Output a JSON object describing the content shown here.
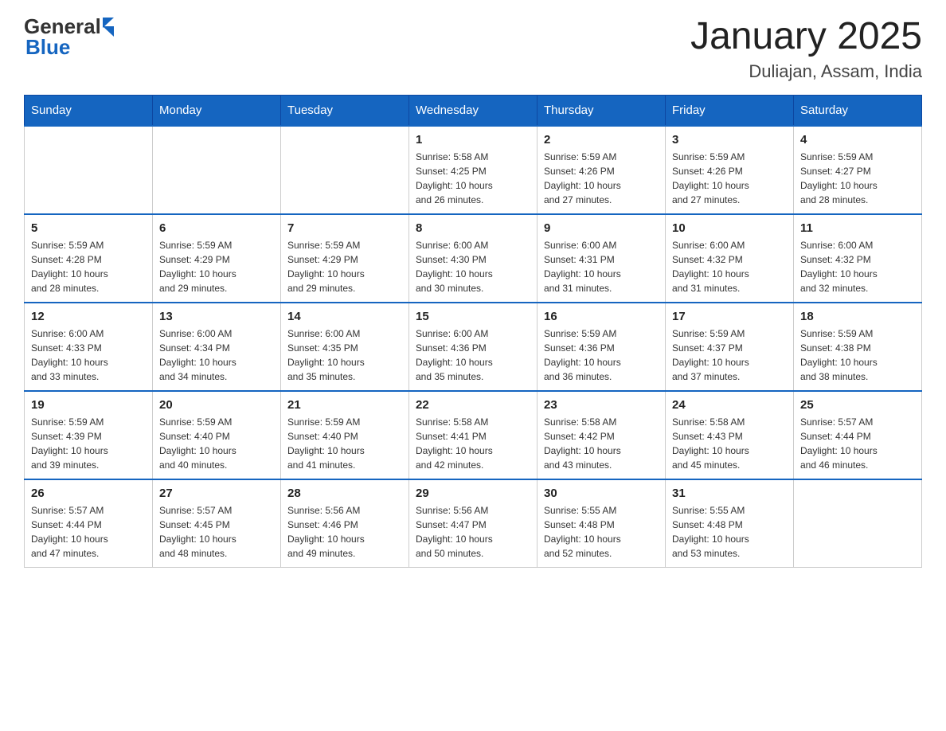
{
  "logo": {
    "text_general": "General",
    "text_blue": "Blue",
    "triangle_label": "logo-triangle"
  },
  "header": {
    "title": "January 2025",
    "subtitle": "Duliajan, Assam, India"
  },
  "weekdays": [
    "Sunday",
    "Monday",
    "Tuesday",
    "Wednesday",
    "Thursday",
    "Friday",
    "Saturday"
  ],
  "weeks": [
    [
      {
        "day": "",
        "info": ""
      },
      {
        "day": "",
        "info": ""
      },
      {
        "day": "",
        "info": ""
      },
      {
        "day": "1",
        "info": "Sunrise: 5:58 AM\nSunset: 4:25 PM\nDaylight: 10 hours\nand 26 minutes."
      },
      {
        "day": "2",
        "info": "Sunrise: 5:59 AM\nSunset: 4:26 PM\nDaylight: 10 hours\nand 27 minutes."
      },
      {
        "day": "3",
        "info": "Sunrise: 5:59 AM\nSunset: 4:26 PM\nDaylight: 10 hours\nand 27 minutes."
      },
      {
        "day": "4",
        "info": "Sunrise: 5:59 AM\nSunset: 4:27 PM\nDaylight: 10 hours\nand 28 minutes."
      }
    ],
    [
      {
        "day": "5",
        "info": "Sunrise: 5:59 AM\nSunset: 4:28 PM\nDaylight: 10 hours\nand 28 minutes."
      },
      {
        "day": "6",
        "info": "Sunrise: 5:59 AM\nSunset: 4:29 PM\nDaylight: 10 hours\nand 29 minutes."
      },
      {
        "day": "7",
        "info": "Sunrise: 5:59 AM\nSunset: 4:29 PM\nDaylight: 10 hours\nand 29 minutes."
      },
      {
        "day": "8",
        "info": "Sunrise: 6:00 AM\nSunset: 4:30 PM\nDaylight: 10 hours\nand 30 minutes."
      },
      {
        "day": "9",
        "info": "Sunrise: 6:00 AM\nSunset: 4:31 PM\nDaylight: 10 hours\nand 31 minutes."
      },
      {
        "day": "10",
        "info": "Sunrise: 6:00 AM\nSunset: 4:32 PM\nDaylight: 10 hours\nand 31 minutes."
      },
      {
        "day": "11",
        "info": "Sunrise: 6:00 AM\nSunset: 4:32 PM\nDaylight: 10 hours\nand 32 minutes."
      }
    ],
    [
      {
        "day": "12",
        "info": "Sunrise: 6:00 AM\nSunset: 4:33 PM\nDaylight: 10 hours\nand 33 minutes."
      },
      {
        "day": "13",
        "info": "Sunrise: 6:00 AM\nSunset: 4:34 PM\nDaylight: 10 hours\nand 34 minutes."
      },
      {
        "day": "14",
        "info": "Sunrise: 6:00 AM\nSunset: 4:35 PM\nDaylight: 10 hours\nand 35 minutes."
      },
      {
        "day": "15",
        "info": "Sunrise: 6:00 AM\nSunset: 4:36 PM\nDaylight: 10 hours\nand 35 minutes."
      },
      {
        "day": "16",
        "info": "Sunrise: 5:59 AM\nSunset: 4:36 PM\nDaylight: 10 hours\nand 36 minutes."
      },
      {
        "day": "17",
        "info": "Sunrise: 5:59 AM\nSunset: 4:37 PM\nDaylight: 10 hours\nand 37 minutes."
      },
      {
        "day": "18",
        "info": "Sunrise: 5:59 AM\nSunset: 4:38 PM\nDaylight: 10 hours\nand 38 minutes."
      }
    ],
    [
      {
        "day": "19",
        "info": "Sunrise: 5:59 AM\nSunset: 4:39 PM\nDaylight: 10 hours\nand 39 minutes."
      },
      {
        "day": "20",
        "info": "Sunrise: 5:59 AM\nSunset: 4:40 PM\nDaylight: 10 hours\nand 40 minutes."
      },
      {
        "day": "21",
        "info": "Sunrise: 5:59 AM\nSunset: 4:40 PM\nDaylight: 10 hours\nand 41 minutes."
      },
      {
        "day": "22",
        "info": "Sunrise: 5:58 AM\nSunset: 4:41 PM\nDaylight: 10 hours\nand 42 minutes."
      },
      {
        "day": "23",
        "info": "Sunrise: 5:58 AM\nSunset: 4:42 PM\nDaylight: 10 hours\nand 43 minutes."
      },
      {
        "day": "24",
        "info": "Sunrise: 5:58 AM\nSunset: 4:43 PM\nDaylight: 10 hours\nand 45 minutes."
      },
      {
        "day": "25",
        "info": "Sunrise: 5:57 AM\nSunset: 4:44 PM\nDaylight: 10 hours\nand 46 minutes."
      }
    ],
    [
      {
        "day": "26",
        "info": "Sunrise: 5:57 AM\nSunset: 4:44 PM\nDaylight: 10 hours\nand 47 minutes."
      },
      {
        "day": "27",
        "info": "Sunrise: 5:57 AM\nSunset: 4:45 PM\nDaylight: 10 hours\nand 48 minutes."
      },
      {
        "day": "28",
        "info": "Sunrise: 5:56 AM\nSunset: 4:46 PM\nDaylight: 10 hours\nand 49 minutes."
      },
      {
        "day": "29",
        "info": "Sunrise: 5:56 AM\nSunset: 4:47 PM\nDaylight: 10 hours\nand 50 minutes."
      },
      {
        "day": "30",
        "info": "Sunrise: 5:55 AM\nSunset: 4:48 PM\nDaylight: 10 hours\nand 52 minutes."
      },
      {
        "day": "31",
        "info": "Sunrise: 5:55 AM\nSunset: 4:48 PM\nDaylight: 10 hours\nand 53 minutes."
      },
      {
        "day": "",
        "info": ""
      }
    ]
  ]
}
